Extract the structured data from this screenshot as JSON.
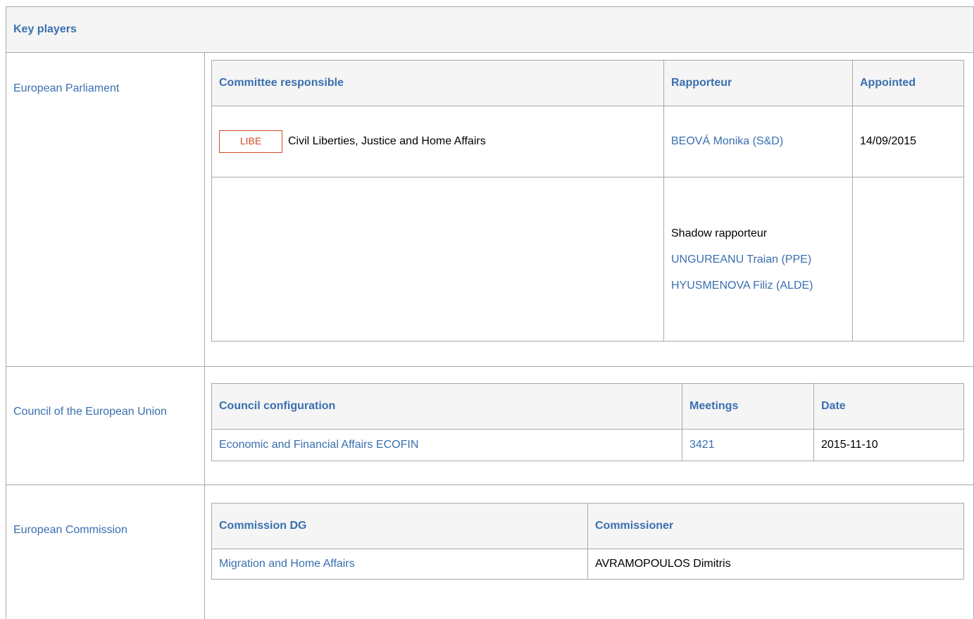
{
  "title": "Key players",
  "parliament": {
    "label": "European Parliament",
    "headers": [
      "Committee responsible",
      "Rapporteur",
      "Appointed"
    ],
    "committee_abbr": "LIBE",
    "committee_name": "Civil Liberties, Justice and Home Affairs",
    "rapporteur": "BEOVÁ Monika (S&D)",
    "appointed": "14/09/2015",
    "shadow_heading": "Shadow rapporteur",
    "shadows": [
      "UNGUREANU Traian (PPE)",
      "HYUSMENOVA Filiz (ALDE)"
    ]
  },
  "council": {
    "label": "Council of the European Union",
    "headers": [
      "Council configuration",
      "Meetings",
      "Date"
    ],
    "configuration": "Economic and Financial Affairs ECOFIN",
    "meeting": "3421",
    "date": "2015-11-10"
  },
  "commission": {
    "label": "European Commission",
    "headers": [
      "Commission DG",
      "Commissioner"
    ],
    "dg": "Migration and Home Affairs",
    "commissioner": "AVRAMOPOULOS Dimitris"
  },
  "colors": {
    "link": "#3a6fb0",
    "badge": "#d2472a",
    "header_bg": "#f5f5f5",
    "border": "#a9a9a9"
  }
}
